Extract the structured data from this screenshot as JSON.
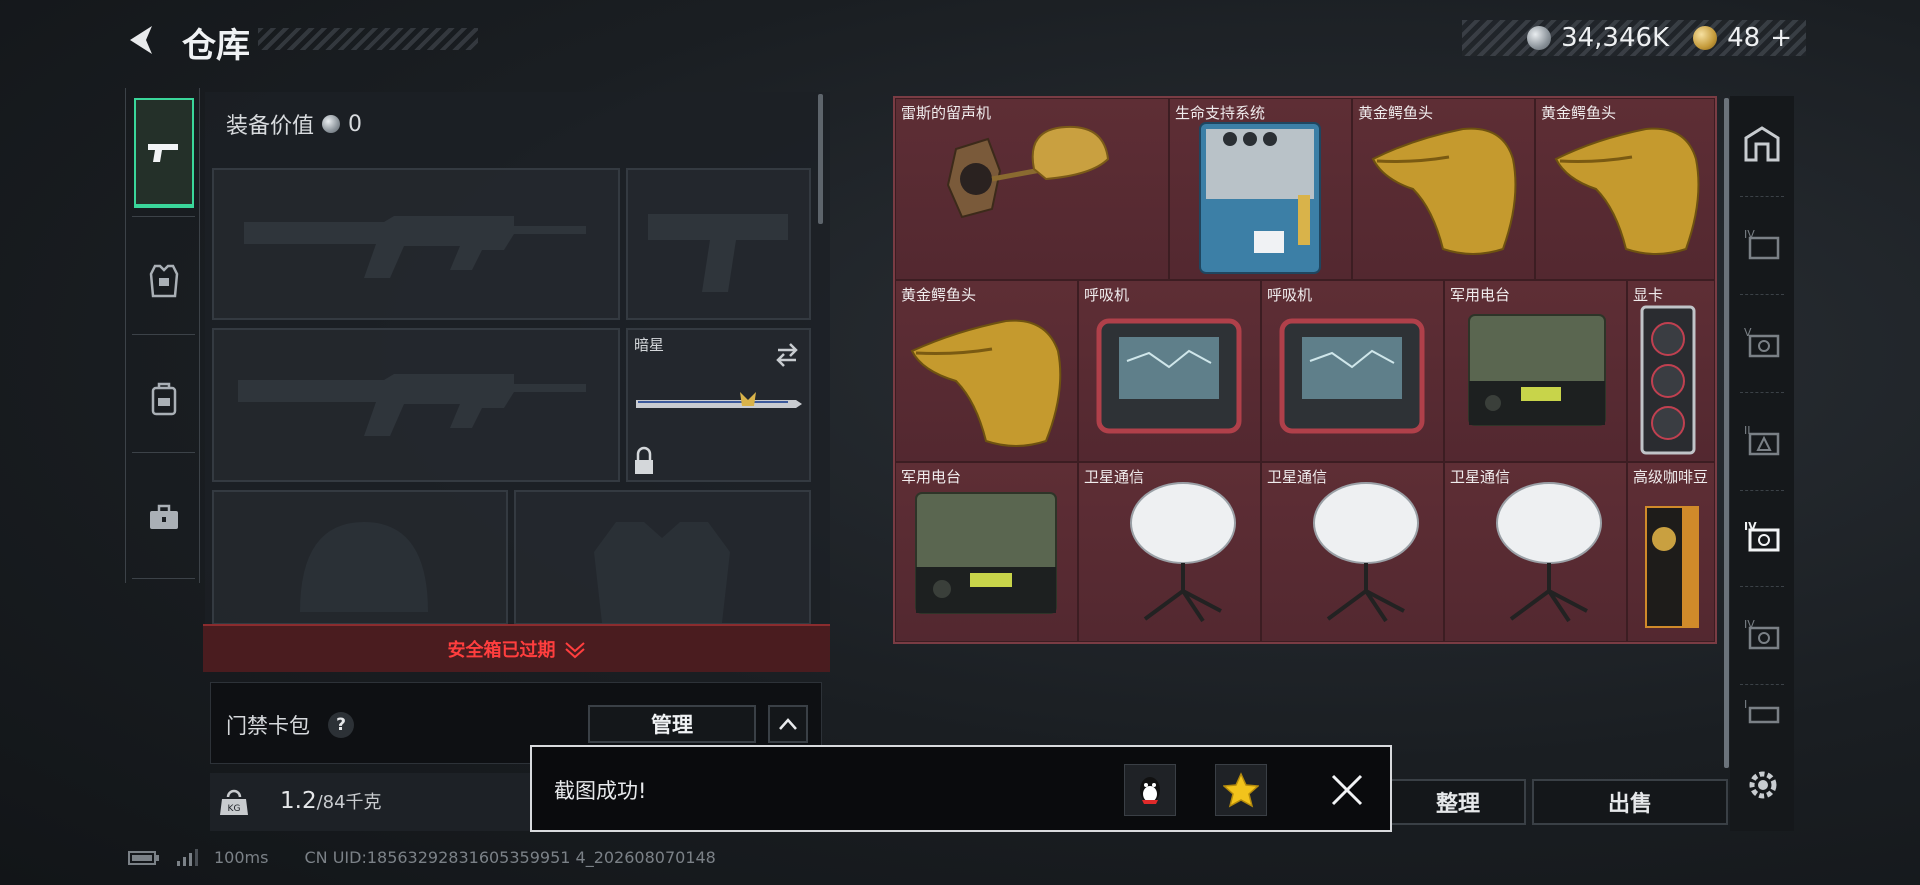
{
  "header": {
    "title": "仓库",
    "currency_silver": "34,346K",
    "currency_gold": "48",
    "add_label": "+"
  },
  "equipment": {
    "value_label": "装备价值",
    "value": "0",
    "melee_slot_label": "暗星",
    "safebox_text": "安全箱已过期",
    "keycard_label": "门禁卡包",
    "help_label": "?",
    "manage_label": "管理",
    "weight_current": "1.2",
    "weight_max": "/84千克"
  },
  "inventory": {
    "items": [
      "雷斯的留声机",
      "生命支持系统",
      "黄金鳄鱼头",
      "黄金鳄鱼头",
      "黄金鳄鱼头",
      "呼吸机",
      "呼吸机",
      "军用电台",
      "显卡",
      "军用电台",
      "卫星通信",
      "卫星通信",
      "卫星通信",
      "高级咖啡豆"
    ],
    "sort_label": "整理",
    "sell_label": "出售"
  },
  "toast": {
    "message": "截图成功!"
  },
  "status": {
    "ping": "100ms",
    "uid": "CN UID:18563292831605359951 4_202608070148"
  },
  "colors": {
    "accent_green": "#3ad69a",
    "grid_bg": "#5a2c32",
    "warning_red": "#ff3e3e"
  }
}
